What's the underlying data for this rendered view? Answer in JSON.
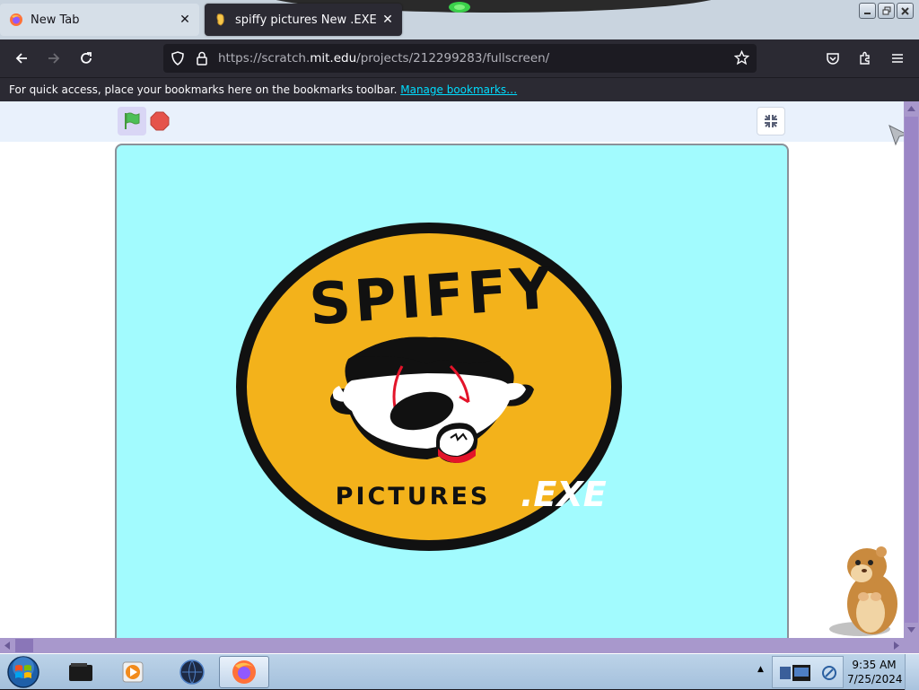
{
  "browser": {
    "tabs": [
      {
        "title": "New Tab",
        "active": false
      },
      {
        "title": "spiffy pictures New .EXE Looks",
        "active": true
      }
    ],
    "url": {
      "prefix": "https://scratch.",
      "domain": "mit.edu",
      "path": "/projects/212299283/fullscreen/"
    },
    "bookmarks_bar": {
      "message": "For quick access, place your bookmarks here on the bookmarks toolbar.",
      "link": "Manage bookmarks…"
    }
  },
  "stage": {
    "background_color": "#a2fbfe",
    "logo": {
      "top_text": "SPIFFY",
      "bottom_text": "PICTURES",
      "suffix": ".EXE"
    }
  },
  "taskbar": {
    "clock_time": "9:35 AM",
    "clock_date": "7/25/2024"
  },
  "colors": {
    "browser_chrome": "#2b2a33",
    "url_field": "#1c1b22",
    "link": "#00ddff",
    "scrollbar": "#a898cc",
    "logo_yellow": "#f3b21b",
    "stop_red": "#e5534b",
    "flag_green": "#4cbf56"
  },
  "icons": [
    "firefox-icon",
    "scratch-icon",
    "close-icon",
    "back-arrow-icon",
    "forward-arrow-icon",
    "reload-icon",
    "shield-icon",
    "lock-icon",
    "star-icon",
    "pocket-icon",
    "extensions-icon",
    "menu-icon",
    "green-flag-icon",
    "stop-icon",
    "exit-fullscreen-icon",
    "windows-start-icon",
    "hamster-icon"
  ]
}
